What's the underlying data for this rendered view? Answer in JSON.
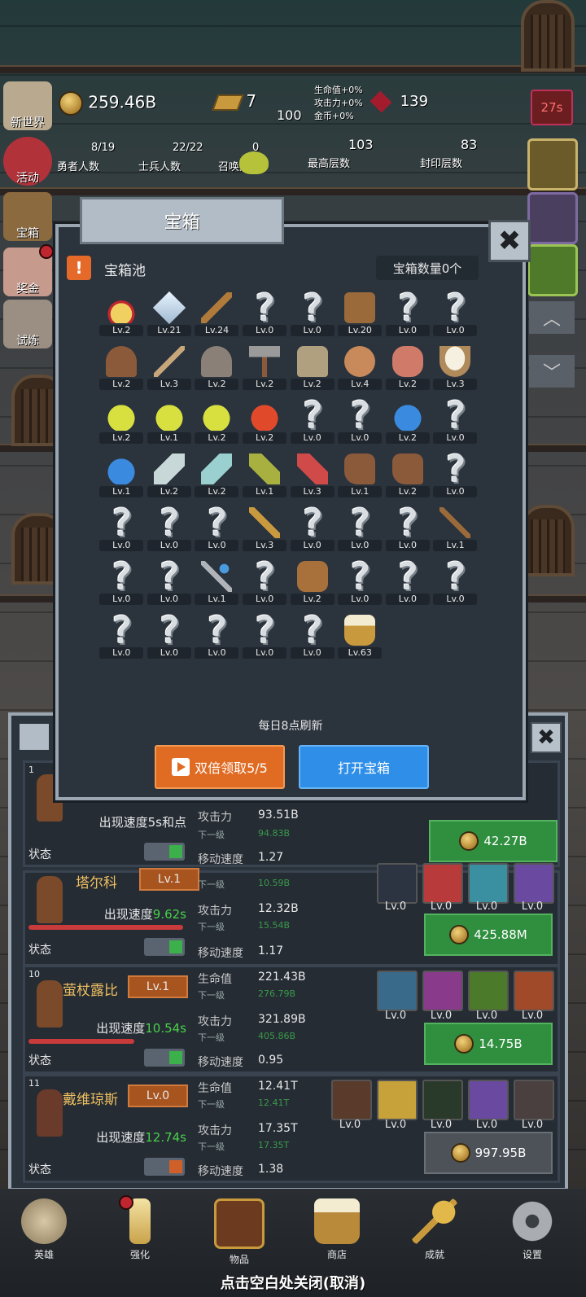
{
  "hud": {
    "gold": "259.46B",
    "bars": "7",
    "gems": "139",
    "bonuses": [
      "生命值+0%",
      "攻击力+0%",
      "金币+0%"
    ],
    "center_value": "100",
    "timer": "27s",
    "heroes_count": "8/19",
    "heroes_label": "勇者人数",
    "soldiers_count": "22/22",
    "soldiers_label": "士兵人数",
    "summon_count": "0",
    "summon_label": "召唤人数",
    "max_floor": "103",
    "max_floor_label": "最高层数",
    "seal_floor": "83",
    "seal_floor_label": "封印层数"
  },
  "side_menu": [
    "新世界",
    "活动",
    "宝箱",
    "奖金",
    "试炼"
  ],
  "dialog": {
    "title": "宝箱",
    "pool_label": "宝箱池",
    "count_label": "宝箱数量0个",
    "refresh_text": "每日8点刷新",
    "double_button": "双倍领取5/5",
    "open_button": "打开宝箱",
    "items": [
      {
        "icon": "crown-icon",
        "level": "Lv.2"
      },
      {
        "icon": "diamond-icon",
        "level": "Lv.21"
      },
      {
        "icon": "sword-icon",
        "level": "Lv.24"
      },
      {
        "icon": "unknown-icon",
        "level": "Lv.0"
      },
      {
        "icon": "unknown-icon",
        "level": "Lv.0"
      },
      {
        "icon": "leather-armor-icon",
        "level": "Lv.20"
      },
      {
        "icon": "unknown-icon",
        "level": "Lv.0"
      },
      {
        "icon": "unknown-icon",
        "level": "Lv.0"
      },
      {
        "icon": "leather-helmet-icon",
        "level": "Lv.2"
      },
      {
        "icon": "dagger-icon",
        "level": "Lv.3"
      },
      {
        "icon": "knight-helmet-icon",
        "level": "Lv.2"
      },
      {
        "icon": "hammer-icon",
        "level": "Lv.2"
      },
      {
        "icon": "great-helm-icon",
        "level": "Lv.2"
      },
      {
        "icon": "ham-icon",
        "level": "Lv.4"
      },
      {
        "icon": "meat-icon",
        "level": "Lv.2"
      },
      {
        "icon": "rice-bowl-icon",
        "level": "Lv.3"
      },
      {
        "icon": "yellow-potion-icon",
        "level": "Lv.2"
      },
      {
        "icon": "yellow-potion-icon",
        "level": "Lv.1"
      },
      {
        "icon": "yellow-potion-icon",
        "level": "Lv.2"
      },
      {
        "icon": "red-potion-icon",
        "level": "Lv.2"
      },
      {
        "icon": "unknown-icon",
        "level": "Lv.0"
      },
      {
        "icon": "unknown-icon",
        "level": "Lv.0"
      },
      {
        "icon": "blue-potion-icon",
        "level": "Lv.2"
      },
      {
        "icon": "unknown-icon",
        "level": "Lv.0"
      },
      {
        "icon": "blue-potion-icon",
        "level": "Lv.1"
      },
      {
        "icon": "empty-bottle-icon",
        "level": "Lv.2"
      },
      {
        "icon": "cyan-bottle-icon",
        "level": "Lv.2"
      },
      {
        "icon": "olive-bottle-icon",
        "level": "Lv.1"
      },
      {
        "icon": "red-bottle-icon",
        "level": "Lv.3"
      },
      {
        "icon": "boot-icon",
        "level": "Lv.1"
      },
      {
        "icon": "boot-icon",
        "level": "Lv.2"
      },
      {
        "icon": "unknown-icon",
        "level": "Lv.0"
      },
      {
        "icon": "unknown-icon",
        "level": "Lv.0"
      },
      {
        "icon": "unknown-icon",
        "level": "Lv.0"
      },
      {
        "icon": "unknown-icon",
        "level": "Lv.0"
      },
      {
        "icon": "torch-icon",
        "level": "Lv.3"
      },
      {
        "icon": "unknown-icon",
        "level": "Lv.0"
      },
      {
        "icon": "unknown-icon",
        "level": "Lv.0"
      },
      {
        "icon": "unknown-icon",
        "level": "Lv.0"
      },
      {
        "icon": "staff-icon",
        "level": "Lv.1"
      },
      {
        "icon": "unknown-icon",
        "level": "Lv.0"
      },
      {
        "icon": "unknown-icon",
        "level": "Lv.0"
      },
      {
        "icon": "wand-icon",
        "level": "Lv.1"
      },
      {
        "icon": "unknown-icon",
        "level": "Lv.0"
      },
      {
        "icon": "backpack-icon",
        "level": "Lv.2"
      },
      {
        "icon": "unknown-icon",
        "level": "Lv.0"
      },
      {
        "icon": "unknown-icon",
        "level": "Lv.0"
      },
      {
        "icon": "unknown-icon",
        "level": "Lv.0"
      },
      {
        "icon": "unknown-icon",
        "level": "Lv.0"
      },
      {
        "icon": "unknown-icon",
        "level": "Lv.0"
      },
      {
        "icon": "unknown-icon",
        "level": "Lv.0"
      },
      {
        "icon": "unknown-icon",
        "level": "Lv.0"
      },
      {
        "icon": "unknown-icon",
        "level": "Lv.0"
      },
      {
        "icon": "beer-mug-icon",
        "level": "Lv.63"
      }
    ]
  },
  "heroes": [
    {
      "idx": "1",
      "name": "",
      "lv": "",
      "speed_label": "出现速度5s和点",
      "speed_value": "",
      "state": "状态",
      "stats": [
        {
          "k": "攻击力",
          "v": "93.51B",
          "next": "94.83B"
        }
      ],
      "move_label": "移动速度",
      "move": "1.27",
      "skills": [],
      "price": "42.27B"
    },
    {
      "idx": "",
      "name": "塔尔科",
      "lv": "Lv.1",
      "speed_label": "出现速度",
      "speed_value": "9.62s",
      "state": "状态",
      "stats": [
        {
          "k": "",
          "v": "",
          "next": "10.59B"
        },
        {
          "k": "攻击力",
          "v": "12.32B",
          "next": "15.54B"
        }
      ],
      "move_label": "移动速度",
      "move": "1.17",
      "skills": [
        "Lv.0",
        "Lv.0",
        "Lv.0",
        "Lv.0"
      ],
      "price": "425.88M"
    },
    {
      "idx": "10",
      "name": "萤杖露比",
      "lv": "Lv.1",
      "speed_label": "出现速度",
      "speed_value": "10.54s",
      "state": "状态",
      "stats": [
        {
          "k": "生命值",
          "v": "221.43B",
          "next": "276.79B"
        },
        {
          "k": "攻击力",
          "v": "321.89B",
          "next": "405.86B"
        }
      ],
      "move_label": "移动速度",
      "move": "0.95",
      "skills": [
        "Lv.0",
        "Lv.0",
        "Lv.0",
        "Lv.0"
      ],
      "price": "14.75B"
    },
    {
      "idx": "11",
      "name": "戴维琼斯",
      "lv": "Lv.0",
      "speed_label": "出现速度",
      "speed_value": "12.74s",
      "state": "状态",
      "stats": [
        {
          "k": "生命值",
          "v": "12.41T",
          "next": "12.41T"
        },
        {
          "k": "攻击力",
          "v": "17.35T",
          "next": "17.35T"
        }
      ],
      "move_label": "移动速度",
      "move": "1.38",
      "skills": [
        "Lv.0",
        "Lv.0",
        "Lv.0",
        "Lv.0",
        "Lv.0"
      ],
      "price": "997.95B"
    }
  ],
  "sub_label": "下一级",
  "nav": [
    "英雄",
    "强化",
    "物品",
    "商店",
    "成就",
    "设置"
  ],
  "close_hint": "点击空白处关闭(取消)",
  "colors": {
    "accent_orange": "#e06b23",
    "accent_blue": "#2f8fe8",
    "buy_green": "#2f8f3f"
  }
}
